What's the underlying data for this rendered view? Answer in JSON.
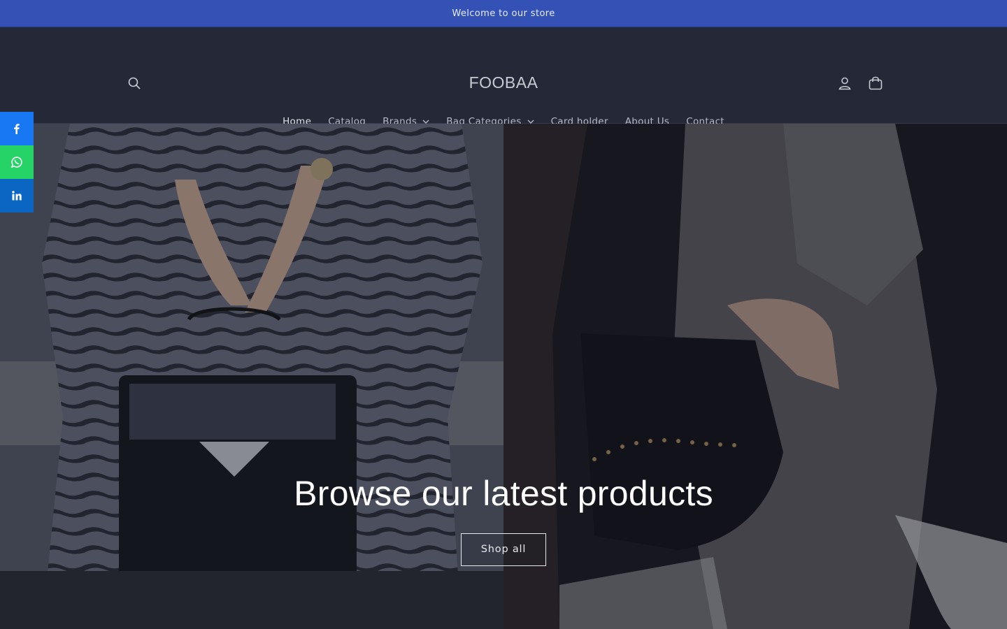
{
  "announcement": {
    "text": "Welcome to our store"
  },
  "header": {
    "logo": "FOOBAA",
    "icons": {
      "search": "search-icon",
      "account": "user-icon",
      "cart": "cart-icon"
    }
  },
  "nav": {
    "items": [
      {
        "label": "Home",
        "active": true,
        "dropdown": false
      },
      {
        "label": "Catalog",
        "active": false,
        "dropdown": false
      },
      {
        "label": "Brands",
        "active": false,
        "dropdown": true
      },
      {
        "label": "Bag Categories",
        "active": false,
        "dropdown": true
      },
      {
        "label": "Card holder",
        "active": false,
        "dropdown": false
      },
      {
        "label": "About Us",
        "active": false,
        "dropdown": false
      },
      {
        "label": "Contact",
        "active": false,
        "dropdown": false
      }
    ]
  },
  "hero": {
    "title": "Browse our latest products",
    "button": "Shop all"
  },
  "share": {
    "items": [
      {
        "network": "facebook",
        "icon": "facebook-icon",
        "color": "#1877f2"
      },
      {
        "network": "whatsapp",
        "icon": "whatsapp-icon",
        "color": "#25d366"
      },
      {
        "network": "linkedin",
        "icon": "linkedin-icon",
        "color": "#0a66c2"
      }
    ]
  },
  "colors": {
    "announcement_bg": "#3452b5",
    "header_bg": "#252837",
    "text_light": "#ffffff"
  }
}
